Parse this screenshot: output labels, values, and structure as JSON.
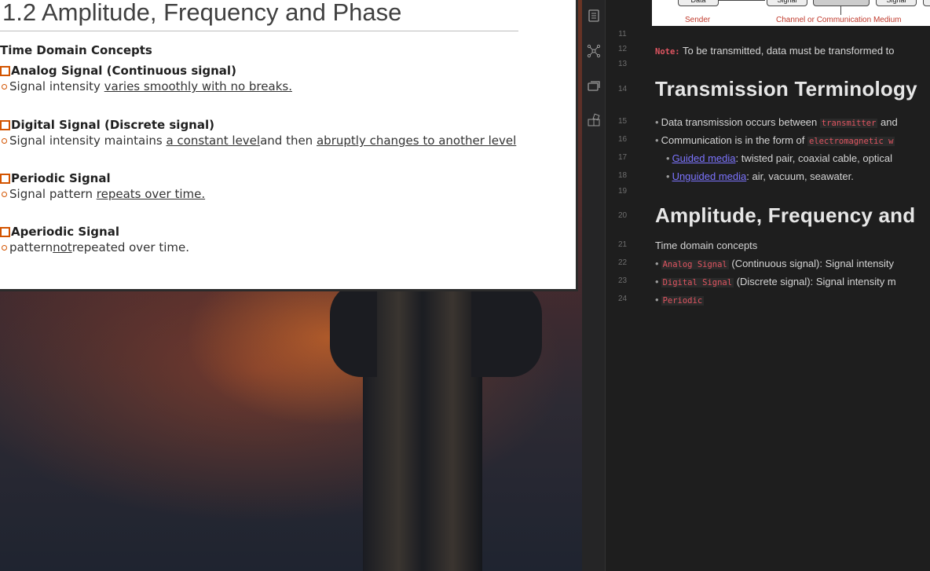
{
  "slide": {
    "title": "1.2 Amplitude, Frequency and Phase",
    "heading": "Time Domain Concepts",
    "items": [
      {
        "head": "Analog Signal (Continuous signal)",
        "sub_pre": "Signal intensity ",
        "sub_u": "varies smoothly with no breaks.",
        "sub_mid": "",
        "sub_u2": ""
      },
      {
        "head": "Digital Signal (Discrete signal)",
        "sub_pre": "Signal intensity maintains ",
        "sub_u": "a constant level ",
        "sub_mid": "and then ",
        "sub_u2": "abruptly changes to another level"
      },
      {
        "head": "Periodic Signal",
        "sub_pre": "Signal pattern ",
        "sub_u": "repeats over time.",
        "sub_mid": "",
        "sub_u2": ""
      },
      {
        "head": "Aperiodic Signal",
        "sub_pre": "pattern ",
        "sub_u": "not",
        "sub_mid": " repeated over time.",
        "sub_u2": ""
      }
    ]
  },
  "activity_icons": [
    "page-icon",
    "graph-icon",
    "cards-icon",
    "blocks-icon"
  ],
  "diagram": {
    "boxes": [
      "Data",
      "Signal",
      "",
      "Signal"
    ],
    "labels": {
      "sender": "Sender",
      "channel": "Channel or Communication Medium"
    }
  },
  "editor": {
    "line_numbers": [
      "11",
      "12",
      "13",
      "14",
      "15",
      "16",
      "17",
      "18",
      "19",
      "20",
      "21",
      "22",
      "23",
      "24"
    ],
    "note_label": "Note:",
    "note_text": " To be transmitted, data must be transformed to",
    "h2_transmission": "Transmission Terminology",
    "l15_pre": "Data transmission occurs between ",
    "l15_code": "transmitter",
    "l15_post": " and",
    "l16_pre": "Communication is in the form of ",
    "l16_code": "electromagnetic w",
    "l17_link": "Guided media",
    "l17_post": ": twisted pair, coaxial cable, optical",
    "l18_link": "Unguided media",
    "l18_post": ": air, vacuum, seawater.",
    "h2_amplitude": "Amplitude, Frequency and",
    "l21": "Time domain concepts",
    "l22_code": "Analog Signal",
    "l22_post": " (Continuous signal): Signal intensity",
    "l23_code": "Digital Signal",
    "l23_post": " (Discrete signal): Signal intensity m",
    "l24_code": "Periodic"
  },
  "colors": {
    "accent_orange": "#d35400",
    "code_red": "#e05561",
    "link_purple": "#7c74ff",
    "editor_bg": "#1e1e1e"
  }
}
